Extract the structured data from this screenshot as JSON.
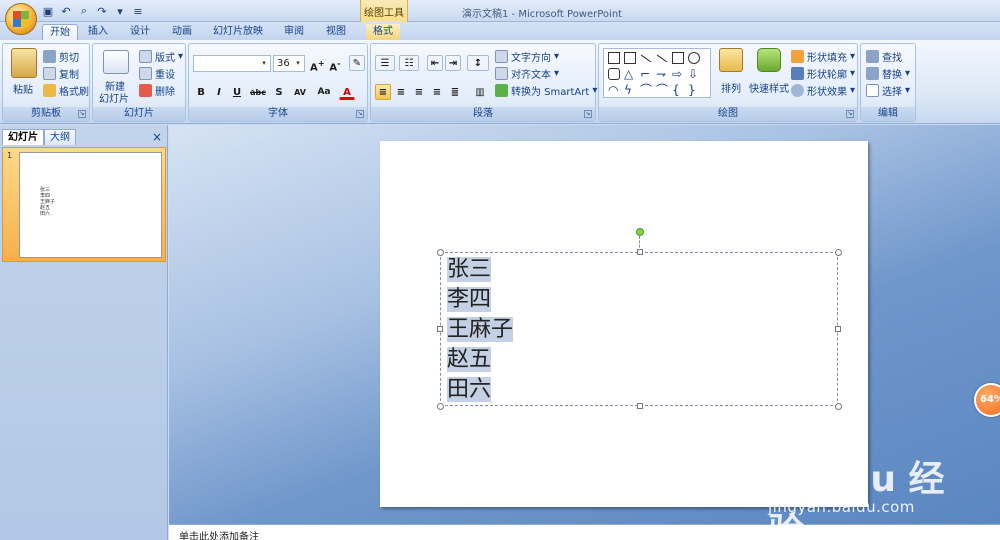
{
  "window": {
    "title": "演示文稿1 - Microsoft PowerPoint",
    "contextual_tool": "绘图工具"
  },
  "tabs": [
    {
      "label": "开始",
      "active": true
    },
    {
      "label": "插入"
    },
    {
      "label": "设计"
    },
    {
      "label": "动画"
    },
    {
      "label": "幻灯片放映"
    },
    {
      "label": "审阅"
    },
    {
      "label": "视图"
    },
    {
      "label": "格式"
    }
  ],
  "ribbon": {
    "clipboard": {
      "name": "剪贴板",
      "paste": "粘贴",
      "cut": "剪切",
      "copy": "复制",
      "format_painter": "格式刷"
    },
    "slides": {
      "name": "幻灯片",
      "new_slide_line1": "新建",
      "new_slide_line2": "幻灯片",
      "layout": "版式",
      "reset": "重设",
      "delete": "删除"
    },
    "font": {
      "name": "字体",
      "font_value": "",
      "size_value": "36",
      "bold": "B",
      "italic": "I",
      "underline": "U",
      "strike": "abc",
      "shadow": "S",
      "spacing": "AV",
      "case": "Aa",
      "color": "A"
    },
    "paragraph": {
      "name": "段落",
      "text_direction": "文字方向",
      "align_text": "对齐文本",
      "smartart": "转换为 SmartArt"
    },
    "drawing": {
      "name": "绘图",
      "arrange": "排列",
      "quick_styles": "快速样式",
      "shape_fill": "形状填充",
      "shape_outline": "形状轮廓",
      "shape_effects": "形状效果"
    },
    "editing": {
      "name": "编辑",
      "find": "查找",
      "replace": "替换",
      "select": "选择"
    }
  },
  "left_pane": {
    "tabs": [
      "幻灯片",
      "大纲"
    ],
    "close": "×",
    "thumbnail_number": "1",
    "thumbnail_lines": [
      "张三",
      "李四",
      "王麻子",
      "赵五",
      "田六"
    ]
  },
  "slide": {
    "lines": [
      "张三",
      "李四",
      "王麻子",
      "赵五",
      "田六"
    ]
  },
  "notes_placeholder": "单击此处添加备注",
  "zoom_badge": "64%",
  "watermark": {
    "brand": "Bai du 经验",
    "url": "jingyan.baidu.com"
  },
  "colors": {
    "accent": "#15428b",
    "selection": "#c4d0e3",
    "active_button": "#f8c54e",
    "contextual": "#f3d67a"
  }
}
